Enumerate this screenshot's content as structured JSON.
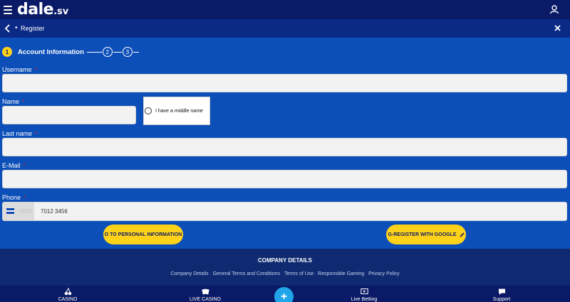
{
  "header": {
    "logo_main": "dale",
    "logo_suffix": ".sv"
  },
  "register_bar": {
    "title": "Register"
  },
  "steps": [
    {
      "number": "1",
      "label": "Account Information"
    },
    {
      "number": "2"
    },
    {
      "number": "3"
    }
  ],
  "form": {
    "username_label": "Username",
    "name_label": "Name",
    "middle_name_option": "I have a middle name",
    "lastname_label": "Last name",
    "email_label": "E-Mail",
    "phone_label": "Phone",
    "required_mark": "*",
    "phone_prefix": "+503",
    "phone_value": "7012 3456"
  },
  "buttons": {
    "next": "O TO PERSONAL INFORMATION",
    "google": "G-REGISTER WITH GOOGLE"
  },
  "footer": {
    "title": "COMPANY DETAILS",
    "links": [
      "Company Details",
      "General Terms and Conditions",
      "Terms of Use",
      "Responsible Gaming",
      "Privacy Policy"
    ]
  },
  "bottom_nav": [
    {
      "label": "CASINO",
      "icon": "cherries-icon"
    },
    {
      "label": "LIVE CASINO",
      "icon": "cards-icon"
    },
    {
      "label": "Live Betting",
      "icon": "play-screen-icon"
    },
    {
      "label": "Support",
      "icon": "chat-icon"
    }
  ],
  "plus_label": "+",
  "colors": {
    "background": "#0d4fb8",
    "topbar": "#0a1a66",
    "accent": "#ffd21a",
    "required": "#e02020",
    "plus": "#1fa5e8"
  }
}
